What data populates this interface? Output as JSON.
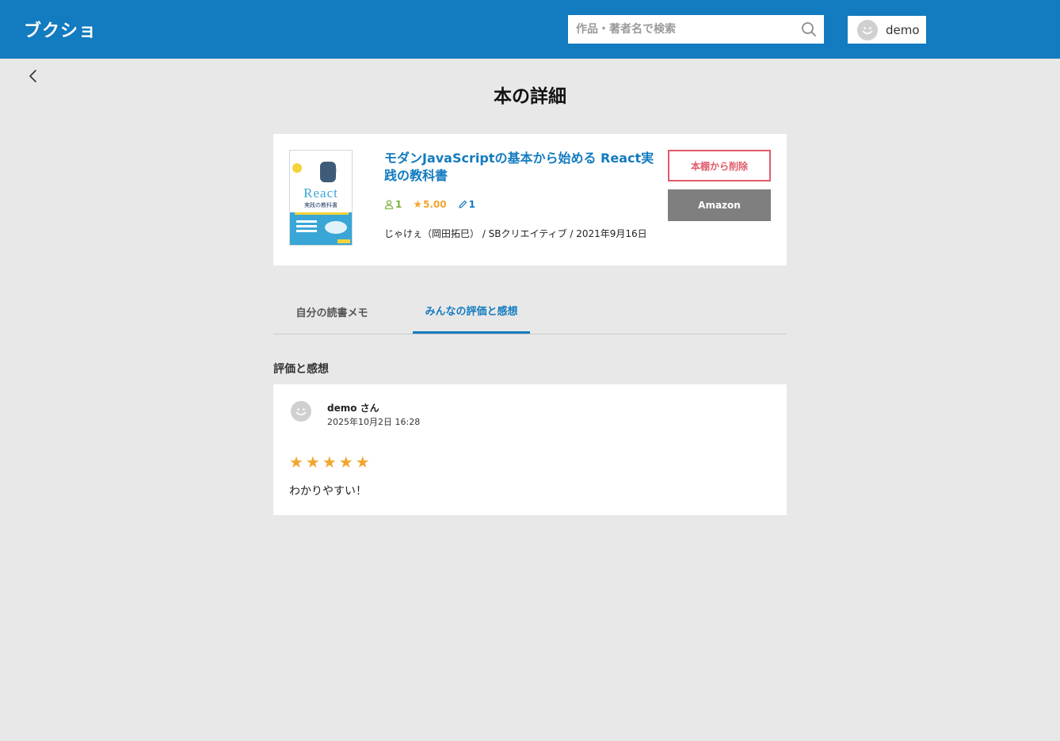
{
  "header": {
    "logo": "ブクショ",
    "search_placeholder": "作品・著者名で検索",
    "user_name": "demo"
  },
  "page": {
    "title": "本の詳細"
  },
  "book": {
    "title": "モダンJavaScriptの基本から始める React実践の教科書",
    "readers_count": "1",
    "rating": "5.00",
    "memo_count": "1",
    "meta": "じゃけぇ（岡田拓巳） / SBクリエイティブ / 2021年9月16日",
    "remove_label": "本棚から削除",
    "amazon_label": "Amazon",
    "cover_text": "React",
    "cover_subtext": "実践の教科書"
  },
  "tabs": [
    {
      "label": "自分の読書メモ",
      "active": false
    },
    {
      "label": "みんなの評価と感想",
      "active": true
    }
  ],
  "reviews_section": {
    "heading": "評価と感想",
    "items": [
      {
        "user": "demo さん",
        "date": "2025年10月2日 16:28",
        "stars": "★★★★★",
        "rating": 5,
        "text": "わかりやすい！"
      }
    ]
  },
  "colors": {
    "brand": "#137bbf",
    "star": "#f0a630",
    "readers": "#7cb342",
    "remove": "#e05b6b",
    "amazon": "#7f7f7f"
  }
}
